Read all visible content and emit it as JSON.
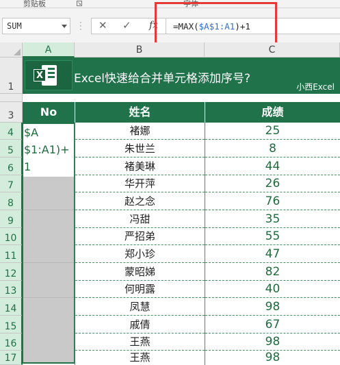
{
  "ribbon": {
    "group_left": "剪贴板",
    "group_right": "字体"
  },
  "name_box": {
    "value": "SUM"
  },
  "formula_bar": {
    "prefix": "=MAX(",
    "ref": "$A$1:A1",
    "suffix": ")+1",
    "cancel_icon": "cancel-icon",
    "enter_icon": "check-icon",
    "fx_label": "fx"
  },
  "columns": [
    "A",
    "B",
    "C"
  ],
  "rows": [
    "1",
    "2",
    "3",
    "4",
    "5",
    "6",
    "7",
    "8",
    "9",
    "10",
    "11",
    "12",
    "13",
    "14",
    "15",
    "16",
    "17"
  ],
  "banner": {
    "title": "Excel快速给合并单元格添加序号?",
    "subtitle": "小西Excel",
    "logo_icon": "excel-logo-icon"
  },
  "table": {
    "headers": [
      "No",
      "姓名",
      "成绩"
    ],
    "editing_cell_text": "$A $1:A1)+ 1",
    "editing_lines": [
      "$A",
      "$1:A1)+",
      "1"
    ],
    "names": [
      "褚娜",
      "朱世兰",
      "褚美琳",
      "华开萍",
      "赵之念",
      "冯甜",
      "严招弟",
      "郑小珍",
      "蒙昭娣",
      "何明露",
      "凤慧",
      "戚倩",
      "王燕",
      "王燕"
    ],
    "scores": [
      "25",
      "8",
      "44",
      "26",
      "76",
      "35",
      "55",
      "47",
      "82",
      "40",
      "98",
      "67",
      "98",
      "98"
    ]
  },
  "colors": {
    "excel_green": "#217346",
    "highlight_red": "#e53935",
    "merged_gray": "#c9c9c9"
  }
}
